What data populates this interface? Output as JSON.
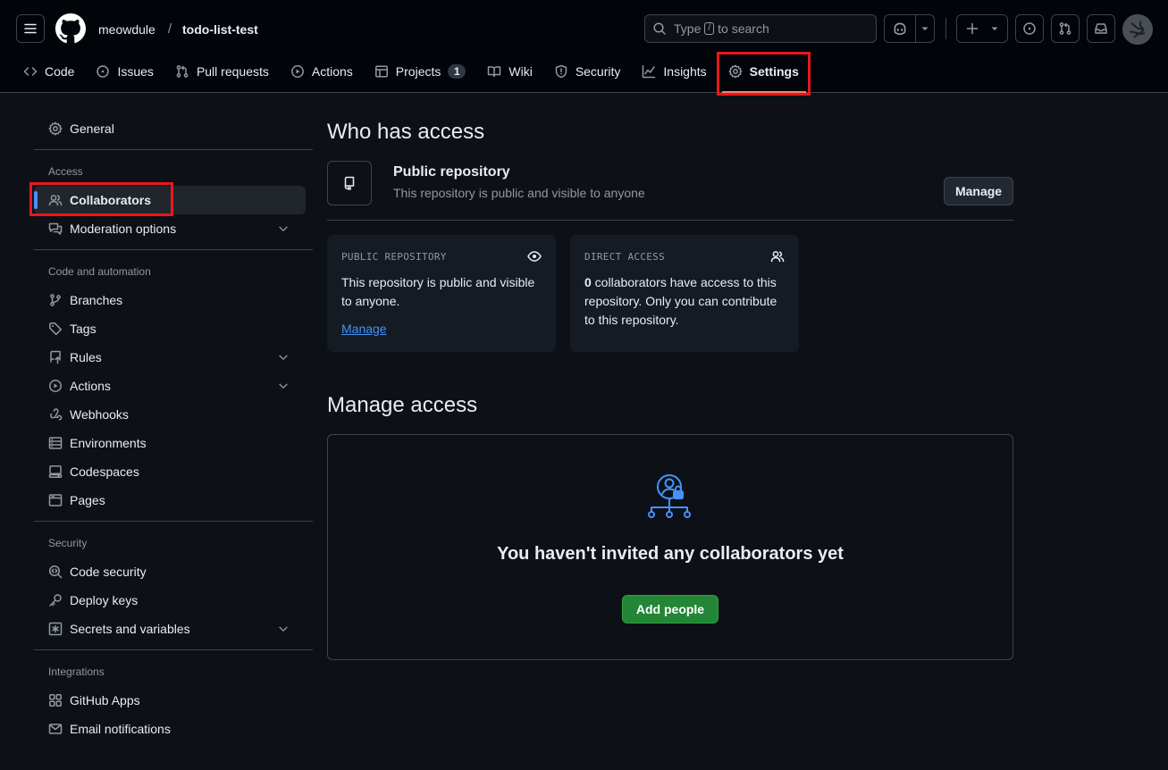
{
  "header": {
    "owner": "meowdule",
    "separator": "/",
    "repo": "todo-list-test",
    "search": {
      "before": "Type",
      "key": "/",
      "after": "to search"
    }
  },
  "repo_nav": {
    "code": "Code",
    "issues": "Issues",
    "pull_requests": "Pull requests",
    "actions": "Actions",
    "projects": "Projects",
    "projects_count": "1",
    "wiki": "Wiki",
    "security": "Security",
    "insights": "Insights",
    "settings": "Settings"
  },
  "sidebar": {
    "general": "General",
    "access_heading": "Access",
    "collaborators": "Collaborators",
    "moderation": "Moderation options",
    "code_automation_heading": "Code and automation",
    "branches": "Branches",
    "tags": "Tags",
    "rules": "Rules",
    "actions": "Actions",
    "webhooks": "Webhooks",
    "environments": "Environments",
    "codespaces": "Codespaces",
    "pages": "Pages",
    "security_heading": "Security",
    "code_security": "Code security",
    "deploy_keys": "Deploy keys",
    "secrets": "Secrets and variables",
    "integrations_heading": "Integrations",
    "github_apps": "GitHub Apps",
    "email_notifications": "Email notifications"
  },
  "main": {
    "who_has_access": "Who has access",
    "public_repo_title": "Public repository",
    "public_repo_desc": "This repository is public and visible to anyone",
    "manage_button": "Manage",
    "card_public": {
      "label": "PUBLIC REPOSITORY",
      "text": "This repository is public and visible to anyone.",
      "link": "Manage"
    },
    "card_direct": {
      "label": "DIRECT ACCESS",
      "count": "0",
      "text": " collaborators have access to this repository. Only you can contribute to this repository."
    },
    "manage_access": "Manage access",
    "empty_title": "You haven't invited any collaborators yet",
    "add_people": "Add people"
  },
  "colors": {
    "background": "#0d1117",
    "header_bg": "#010409",
    "accent_link": "#4493f8",
    "primary_button": "#238636",
    "highlight_box": "#e5191f",
    "active_tab_underline": "#f78166"
  }
}
